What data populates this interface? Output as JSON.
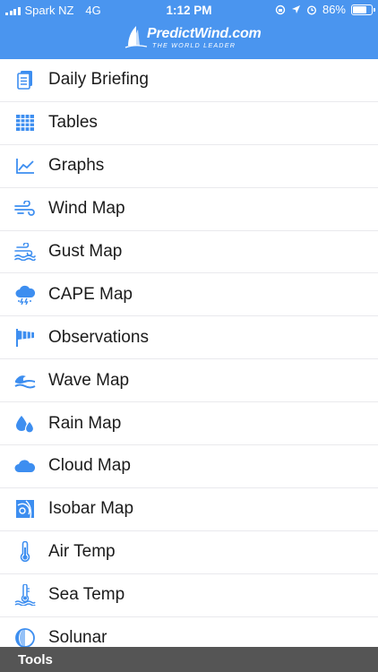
{
  "status_bar": {
    "carrier": "Spark NZ",
    "network": "4G",
    "time": "1:12 PM",
    "battery": "86%",
    "battery_level": 0.86
  },
  "header": {
    "brand": "PredictWind.com",
    "tagline": "THE WORLD LEADER"
  },
  "menu": [
    {
      "label": "Daily Briefing",
      "icon": "daily-briefing-icon"
    },
    {
      "label": "Tables",
      "icon": "tables-icon"
    },
    {
      "label": "Graphs",
      "icon": "graphs-icon"
    },
    {
      "label": "Wind Map",
      "icon": "wind-icon"
    },
    {
      "label": "Gust Map",
      "icon": "gust-icon"
    },
    {
      "label": "CAPE Map",
      "icon": "storm-cloud-icon"
    },
    {
      "label": "Observations",
      "icon": "windsock-icon"
    },
    {
      "label": "Wave Map",
      "icon": "wave-icon"
    },
    {
      "label": "Rain Map",
      "icon": "raindrops-icon"
    },
    {
      "label": "Cloud Map",
      "icon": "cloud-icon"
    },
    {
      "label": "Isobar Map",
      "icon": "isobar-icon"
    },
    {
      "label": "Air Temp",
      "icon": "thermometer-icon"
    },
    {
      "label": "Sea Temp",
      "icon": "sea-thermometer-icon"
    },
    {
      "label": "Solunar",
      "icon": "moon-phase-icon"
    }
  ],
  "footer": {
    "label": "Tools"
  },
  "colors": {
    "header_bg": "#4a95ef",
    "icon": "#3d8ef0",
    "footer_bg": "#555555"
  }
}
